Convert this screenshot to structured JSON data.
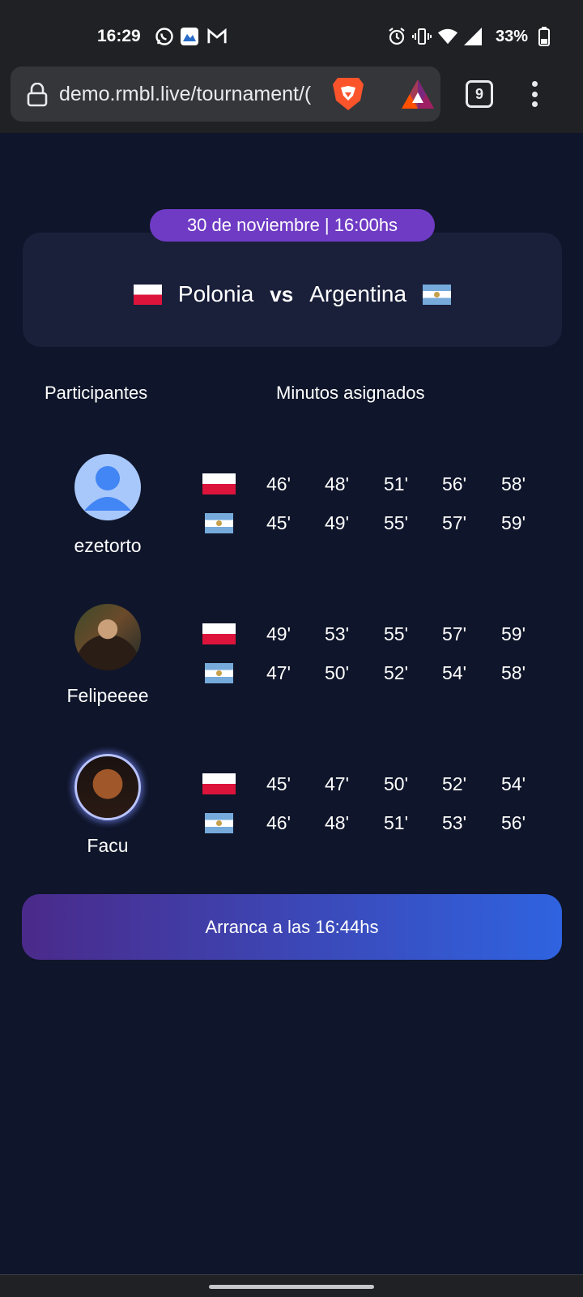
{
  "status_bar": {
    "time": "16:29",
    "battery": "33%",
    "icons": [
      "whatsapp-icon",
      "maps-icon",
      "gmail-icon",
      "alarm-icon",
      "vibrate-icon",
      "wifi-icon",
      "signal-icon",
      "battery-icon"
    ]
  },
  "browser": {
    "url": "demo.rmbl.live/tournament/(",
    "tab_count": "9",
    "icons": [
      "lock-icon",
      "brave-lion-icon",
      "bat-rewards-icon",
      "tabs-icon",
      "more-vert-icon"
    ]
  },
  "match": {
    "date": "30 de noviembre | 16:00hs",
    "team1": "Polonia",
    "vs": "vs",
    "team2": "Argentina",
    "colors": {
      "poland_red": "#dc143c",
      "argentina_blue": "#75aadb"
    }
  },
  "headers": {
    "participants": "Participantes",
    "minutes": "Minutos asignados"
  },
  "participants": [
    {
      "name": "ezetorto",
      "avatar": "default-user-avatar",
      "poland": [
        "46'",
        "48'",
        "51'",
        "56'",
        "58'"
      ],
      "argentina": [
        "45'",
        "49'",
        "55'",
        "57'",
        "59'"
      ]
    },
    {
      "name": "Felipeeee",
      "avatar": "photo-avatar",
      "poland": [
        "49'",
        "53'",
        "55'",
        "57'",
        "59'"
      ],
      "argentina": [
        "47'",
        "50'",
        "52'",
        "54'",
        "58'"
      ]
    },
    {
      "name": "Facu",
      "avatar": "photo-avatar",
      "poland": [
        "45'",
        "47'",
        "50'",
        "52'",
        "54'"
      ],
      "argentina": [
        "46'",
        "48'",
        "51'",
        "53'",
        "56'"
      ]
    }
  ],
  "start_button": {
    "label": "Arranca a las 16:44hs",
    "colors": {
      "from": "#4a2a8a",
      "to": "#2f63e0"
    }
  }
}
